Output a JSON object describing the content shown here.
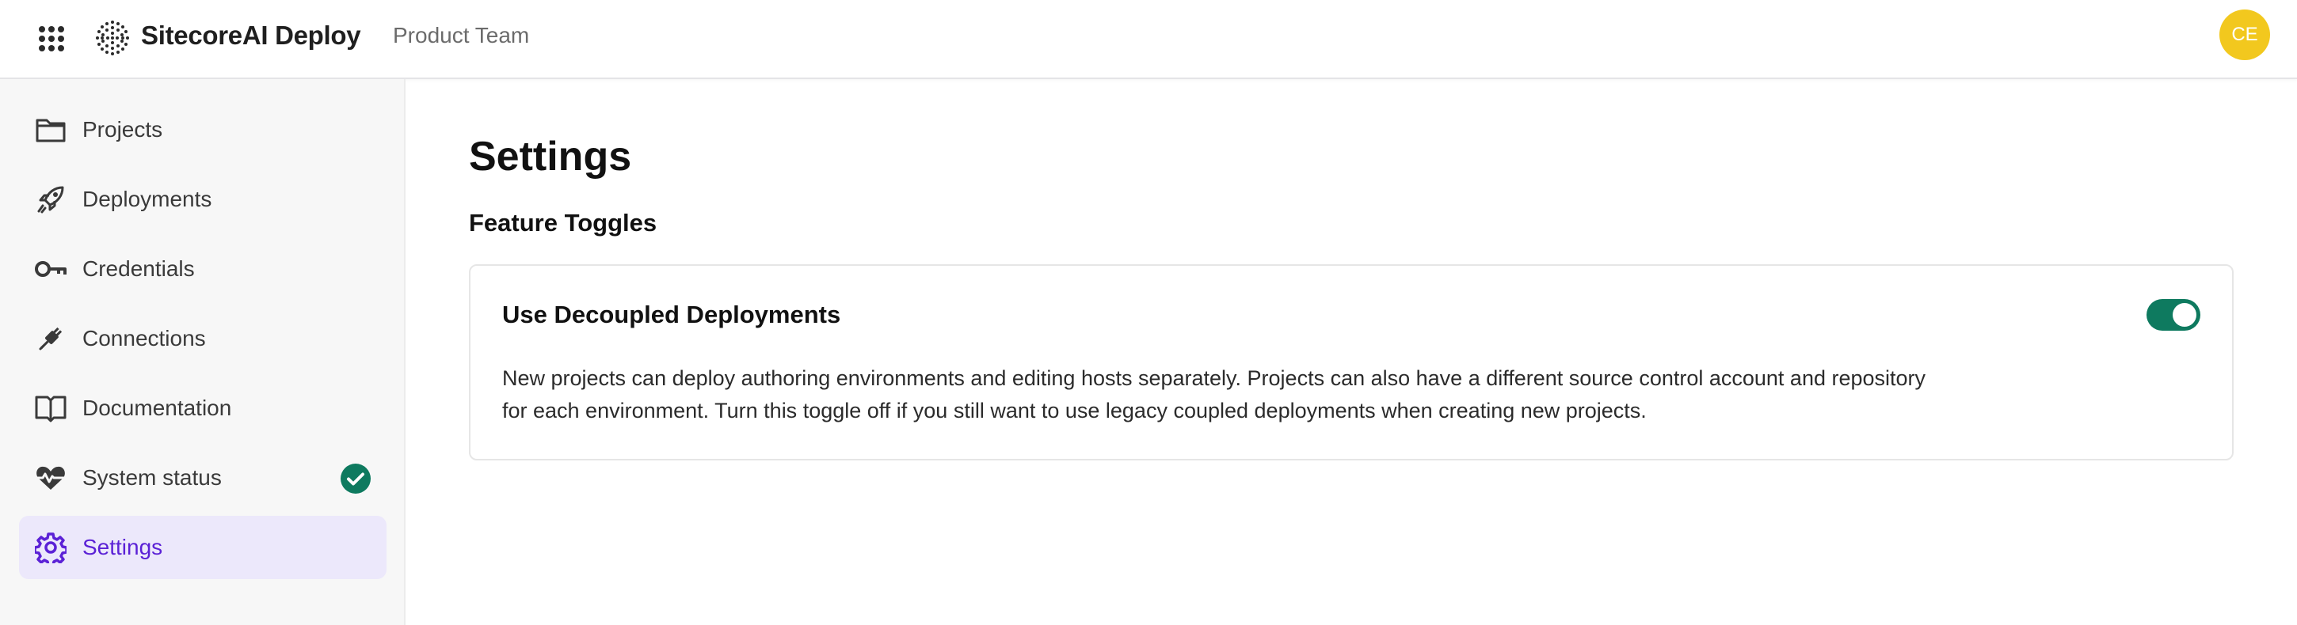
{
  "header": {
    "brand": "SitecoreAI Deploy",
    "organization": "Product Team",
    "avatar_initials": "CE",
    "avatar_color": "#f2c81e",
    "icons": {
      "app_switcher": "grid-dots-icon",
      "logo": "sitecore-logo-icon"
    }
  },
  "sidebar": {
    "items": [
      {
        "label": "Projects",
        "icon": "folder-icon"
      },
      {
        "label": "Deployments",
        "icon": "rocket-icon"
      },
      {
        "label": "Credentials",
        "icon": "key-icon"
      },
      {
        "label": "Connections",
        "icon": "plug-icon"
      },
      {
        "label": "Documentation",
        "icon": "book-icon"
      },
      {
        "label": "System status",
        "icon": "heartbeat-icon",
        "status_icon": "check-circle-icon",
        "status_color": "#0e7a5f"
      },
      {
        "label": "Settings",
        "icon": "gear-icon",
        "active": true
      }
    ],
    "active_color": "#5b21d6",
    "active_background": "#ece8fb"
  },
  "main": {
    "title": "Settings",
    "section_title": "Feature Toggles",
    "card": {
      "title": "Use Decoupled Deployments",
      "description": "New projects can deploy authoring environments and editing hosts separately. Projects can also have a different source control account and repository for each environment. Turn this toggle off if you still want to use legacy coupled deployments when creating new projects.",
      "toggle_on": true,
      "toggle_color": "#0e7a5f"
    }
  }
}
